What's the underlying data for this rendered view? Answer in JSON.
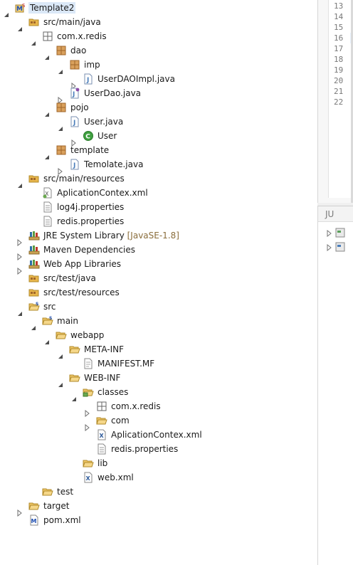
{
  "tree": [
    {
      "label": "Template2",
      "level": 0,
      "toggle": "expanded",
      "icon": "maven-project-icon"
    },
    {
      "label": "src/main/java",
      "level": 1,
      "toggle": "expanded",
      "icon": "source-folder-icon"
    },
    {
      "label": "com.x.redis",
      "level": 2,
      "toggle": "expanded",
      "icon": "package-empty-icon"
    },
    {
      "label": "dao",
      "level": 3,
      "toggle": "expanded",
      "icon": "package-icon"
    },
    {
      "label": "imp",
      "level": 4,
      "toggle": "expanded",
      "icon": "package-icon"
    },
    {
      "label": "UserDAOImpl.java",
      "level": 5,
      "toggle": "collapsed",
      "icon": "java-file-icon"
    },
    {
      "label": "UserDao.java",
      "level": 4,
      "toggle": "collapsed",
      "icon": "java-interface-file-icon"
    },
    {
      "label": "pojo",
      "level": 3,
      "toggle": "expanded",
      "icon": "package-icon"
    },
    {
      "label": "User.java",
      "level": 4,
      "toggle": "expanded",
      "icon": "java-file-icon"
    },
    {
      "label": "User",
      "level": 5,
      "toggle": "collapsed",
      "icon": "class-icon"
    },
    {
      "label": "template",
      "level": 3,
      "toggle": "expanded",
      "icon": "package-icon"
    },
    {
      "label": "Temolate.java",
      "level": 4,
      "toggle": "collapsed",
      "icon": "java-file-icon"
    },
    {
      "label": "src/main/resources",
      "level": 1,
      "toggle": "expanded",
      "icon": "source-folder-icon"
    },
    {
      "label": "AplicationContex.xml",
      "level": 2,
      "toggle": "none",
      "icon": "spring-xml-icon"
    },
    {
      "label": "log4j.properties",
      "level": 2,
      "toggle": "none",
      "icon": "properties-file-icon"
    },
    {
      "label": "redis.properties",
      "level": 2,
      "toggle": "none",
      "icon": "properties-file-icon"
    },
    {
      "label": "JRE System Library",
      "decoration": "[JavaSE-1.8]",
      "level": 1,
      "toggle": "collapsed",
      "icon": "library-icon"
    },
    {
      "label": "Maven Dependencies",
      "level": 1,
      "toggle": "collapsed",
      "icon": "library-icon"
    },
    {
      "label": "Web App Libraries",
      "level": 1,
      "toggle": "collapsed",
      "icon": "library-icon"
    },
    {
      "label": "src/test/java",
      "level": 1,
      "toggle": "none",
      "icon": "source-folder-icon"
    },
    {
      "label": "src/test/resources",
      "level": 1,
      "toggle": "none",
      "icon": "source-folder-icon"
    },
    {
      "label": "src",
      "level": 1,
      "toggle": "expanded",
      "icon": "folder-s-icon"
    },
    {
      "label": "main",
      "level": 2,
      "toggle": "expanded",
      "icon": "folder-s-icon"
    },
    {
      "label": "webapp",
      "level": 3,
      "toggle": "expanded",
      "icon": "folder-open-icon"
    },
    {
      "label": "META-INF",
      "level": 4,
      "toggle": "expanded",
      "icon": "folder-open-icon"
    },
    {
      "label": "MANIFEST.MF",
      "level": 5,
      "toggle": "none",
      "icon": "text-file-icon"
    },
    {
      "label": "WEB-INF",
      "level": 4,
      "toggle": "expanded",
      "icon": "folder-open-icon"
    },
    {
      "label": "classes",
      "level": 5,
      "toggle": "expanded",
      "icon": "output-folder-icon"
    },
    {
      "label": "com.x.redis",
      "level": 6,
      "toggle": "collapsed",
      "icon": "package-empty-icon"
    },
    {
      "label": "com",
      "level": 6,
      "toggle": "collapsed",
      "icon": "folder-open-icon"
    },
    {
      "label": "AplicationContex.xml",
      "level": 6,
      "toggle": "none",
      "icon": "xml-file-icon"
    },
    {
      "label": "redis.properties",
      "level": 6,
      "toggle": "none",
      "icon": "properties-file-icon"
    },
    {
      "label": "lib",
      "level": 5,
      "toggle": "none",
      "icon": "folder-open-icon"
    },
    {
      "label": "web.xml",
      "level": 5,
      "toggle": "none",
      "icon": "xml-file-icon"
    },
    {
      "label": "test",
      "level": 2,
      "toggle": "none",
      "icon": "folder-open-icon"
    },
    {
      "label": "target",
      "level": 1,
      "toggle": "collapsed",
      "icon": "folder-open-icon"
    },
    {
      "label": "pom.xml",
      "level": 1,
      "toggle": "none",
      "icon": "maven-pom-icon"
    }
  ],
  "editor": {
    "line_numbers": [
      "13",
      "14",
      "15",
      "16",
      "17",
      "18",
      "19",
      "20",
      "21",
      "22"
    ],
    "closing_brace": "}"
  },
  "junit": {
    "tab_label": "JU"
  },
  "colors": {
    "package": "#a0662a",
    "folder": "#e8b64c",
    "java": "#4a7ebb",
    "class": "#3fa040",
    "library": "#2e6ea6",
    "maven": "#1f4fb3"
  }
}
